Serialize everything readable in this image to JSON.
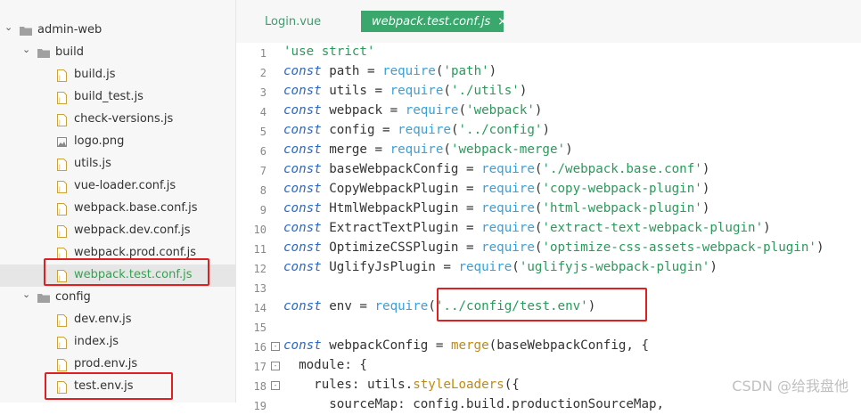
{
  "sidebar": {
    "items": [
      {
        "label": "admin-web",
        "type": "folder",
        "depth": 0,
        "expanded": true
      },
      {
        "label": "build",
        "type": "folder",
        "depth": 1,
        "expanded": true
      },
      {
        "label": "build.js",
        "type": "js",
        "depth": 2
      },
      {
        "label": "build_test.js",
        "type": "js",
        "depth": 2
      },
      {
        "label": "check-versions.js",
        "type": "js",
        "depth": 2
      },
      {
        "label": "logo.png",
        "type": "img",
        "depth": 2
      },
      {
        "label": "utils.js",
        "type": "js",
        "depth": 2
      },
      {
        "label": "vue-loader.conf.js",
        "type": "js",
        "depth": 2
      },
      {
        "label": "webpack.base.conf.js",
        "type": "js",
        "depth": 2
      },
      {
        "label": "webpack.dev.conf.js",
        "type": "js",
        "depth": 2
      },
      {
        "label": "webpack.prod.conf.js",
        "type": "js",
        "depth": 2
      },
      {
        "label": "webpack.test.conf.js",
        "type": "js",
        "depth": 2,
        "selected": true
      },
      {
        "label": "config",
        "type": "folder",
        "depth": 1,
        "expanded": true
      },
      {
        "label": "dev.env.js",
        "type": "js",
        "depth": 2
      },
      {
        "label": "index.js",
        "type": "js",
        "depth": 2
      },
      {
        "label": "prod.env.js",
        "type": "js",
        "depth": 2
      },
      {
        "label": "test.env.js",
        "type": "js",
        "depth": 2
      }
    ]
  },
  "tabs": [
    {
      "label": "Login.vue",
      "active": false
    },
    {
      "label": "webpack.test.conf.js",
      "active": true,
      "close": "×"
    }
  ],
  "code_lines": [
    {
      "n": "1",
      "tokens": [
        [
          "str",
          "'use strict'"
        ]
      ]
    },
    {
      "n": "2",
      "tokens": [
        [
          "kw",
          "const"
        ],
        [
          "",
          " path = "
        ],
        [
          "req",
          "require"
        ],
        [
          "",
          "("
        ],
        [
          "str",
          "'path'"
        ],
        [
          "",
          ")"
        ]
      ]
    },
    {
      "n": "3",
      "tokens": [
        [
          "kw",
          "const"
        ],
        [
          "",
          " utils = "
        ],
        [
          "req",
          "require"
        ],
        [
          "",
          "("
        ],
        [
          "str",
          "'./utils'"
        ],
        [
          "",
          ")"
        ]
      ]
    },
    {
      "n": "4",
      "tokens": [
        [
          "kw",
          "const"
        ],
        [
          "",
          " webpack = "
        ],
        [
          "req",
          "require"
        ],
        [
          "",
          "("
        ],
        [
          "str",
          "'webpack'"
        ],
        [
          "",
          ")"
        ]
      ]
    },
    {
      "n": "5",
      "tokens": [
        [
          "kw",
          "const"
        ],
        [
          "",
          " config = "
        ],
        [
          "req",
          "require"
        ],
        [
          "",
          "("
        ],
        [
          "str",
          "'../config'"
        ],
        [
          "",
          ")"
        ]
      ]
    },
    {
      "n": "6",
      "tokens": [
        [
          "kw",
          "const"
        ],
        [
          "",
          " merge = "
        ],
        [
          "req",
          "require"
        ],
        [
          "",
          "("
        ],
        [
          "str",
          "'webpack-merge'"
        ],
        [
          "",
          ")"
        ]
      ]
    },
    {
      "n": "7",
      "tokens": [
        [
          "kw",
          "const"
        ],
        [
          "",
          " baseWebpackConfig = "
        ],
        [
          "req",
          "require"
        ],
        [
          "",
          "("
        ],
        [
          "str",
          "'./webpack.base.conf'"
        ],
        [
          "",
          ")"
        ]
      ]
    },
    {
      "n": "8",
      "tokens": [
        [
          "kw",
          "const"
        ],
        [
          "",
          " CopyWebpackPlugin = "
        ],
        [
          "req",
          "require"
        ],
        [
          "",
          "("
        ],
        [
          "str",
          "'copy-webpack-plugin'"
        ],
        [
          "",
          ")"
        ]
      ]
    },
    {
      "n": "9",
      "tokens": [
        [
          "kw",
          "const"
        ],
        [
          "",
          " HtmlWebpackPlugin = "
        ],
        [
          "req",
          "require"
        ],
        [
          "",
          "("
        ],
        [
          "str",
          "'html-webpack-plugin'"
        ],
        [
          "",
          ")"
        ]
      ]
    },
    {
      "n": "10",
      "tokens": [
        [
          "kw",
          "const"
        ],
        [
          "",
          " ExtractTextPlugin = "
        ],
        [
          "req",
          "require"
        ],
        [
          "",
          "("
        ],
        [
          "str",
          "'extract-text-webpack-plugin'"
        ],
        [
          "",
          ")"
        ]
      ]
    },
    {
      "n": "11",
      "tokens": [
        [
          "kw",
          "const"
        ],
        [
          "",
          " OptimizeCSSPlugin = "
        ],
        [
          "req",
          "require"
        ],
        [
          "",
          "("
        ],
        [
          "str",
          "'optimize-css-assets-webpack-plugin'"
        ],
        [
          "",
          ")"
        ]
      ]
    },
    {
      "n": "12",
      "tokens": [
        [
          "kw",
          "const"
        ],
        [
          "",
          " UglifyJsPlugin = "
        ],
        [
          "req",
          "require"
        ],
        [
          "",
          "("
        ],
        [
          "str",
          "'uglifyjs-webpack-plugin'"
        ],
        [
          "",
          ")"
        ]
      ]
    },
    {
      "n": "13",
      "tokens": []
    },
    {
      "n": "14",
      "tokens": [
        [
          "kw",
          "const"
        ],
        [
          "",
          " env = "
        ],
        [
          "req",
          "require"
        ],
        [
          "",
          "("
        ],
        [
          "str",
          "'../config/test.env'"
        ],
        [
          "",
          ")"
        ]
      ]
    },
    {
      "n": "15",
      "tokens": []
    },
    {
      "n": "16",
      "fold": "-",
      "tokens": [
        [
          "kw",
          "const"
        ],
        [
          "",
          " webpackConfig = "
        ],
        [
          "fn",
          "merge"
        ],
        [
          "",
          "(baseWebpackConfig, {"
        ]
      ]
    },
    {
      "n": "17",
      "fold": "-",
      "tokens": [
        [
          "",
          "  module: {"
        ]
      ]
    },
    {
      "n": "18",
      "fold": "-",
      "tokens": [
        [
          "",
          "    rules: utils."
        ],
        [
          "fn",
          "styleLoaders"
        ],
        [
          "",
          "({"
        ]
      ]
    },
    {
      "n": "19",
      "tokens": [
        [
          "",
          "      sourceMap: config.build.productionSourceMap,"
        ]
      ]
    }
  ],
  "watermark": "CSDN @给我盘他",
  "colors": {
    "accent": "#3aa76d",
    "highlight_box": "#e02020",
    "keyword": "#2b68c4",
    "string": "#2a9a5a"
  }
}
